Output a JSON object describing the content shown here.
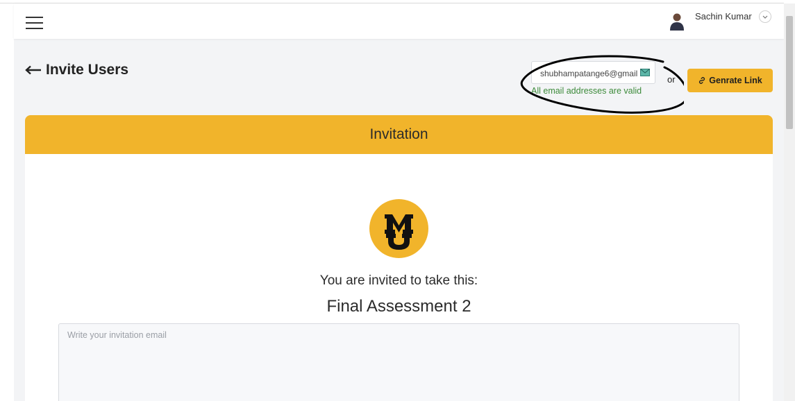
{
  "header": {
    "user_name": "Sachin Kumar"
  },
  "page": {
    "title": "Invite Users"
  },
  "invite_bar": {
    "email_value": "shubhampatange6@gmail",
    "validation_message": "All email addresses are valid",
    "or_label": "or",
    "generate_button_label": "Genrate Link"
  },
  "card": {
    "header_title": "Invitation",
    "invite_line": "You are invited to take this:",
    "assessment_title": "Final Assessment 2",
    "email_placeholder": "Write your invitation email"
  },
  "colors": {
    "accent": "#f1b42b",
    "valid_text": "#3c8a3a",
    "background": "#f3f4f6"
  },
  "icons": [
    "menu-icon",
    "user-icon",
    "chevron-down-icon",
    "arrow-left-icon",
    "mail-icon",
    "link-icon",
    "mizzou-logo"
  ]
}
